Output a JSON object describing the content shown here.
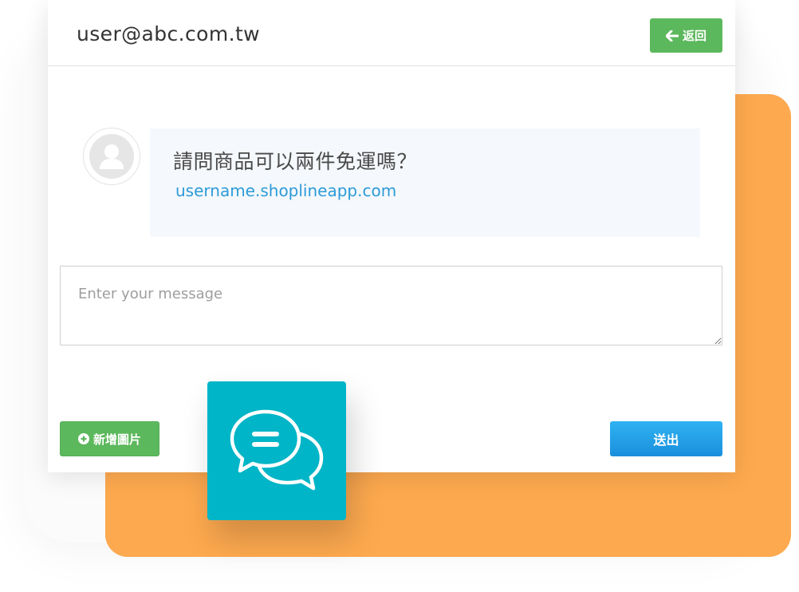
{
  "header": {
    "email": "user@abc.com.tw",
    "back_label": "返回"
  },
  "message": {
    "text": "請問商品可以兩件免運嗎？",
    "link": "username.shoplineapp.com"
  },
  "composer": {
    "placeholder": "Enter your message",
    "value": ""
  },
  "actions": {
    "add_image_label": "新增圖片",
    "send_label": "送出"
  },
  "icons": {
    "back": "arrow-left-icon",
    "add_image": "plus-circle-icon",
    "avatar": "user-avatar-icon",
    "chat": "chat-bubbles-icon"
  },
  "colors": {
    "green": "#5cb85c",
    "blue": "#1e9be3",
    "orange": "#fda94f",
    "teal": "#00b5c7",
    "link": "#2d9bd8"
  }
}
